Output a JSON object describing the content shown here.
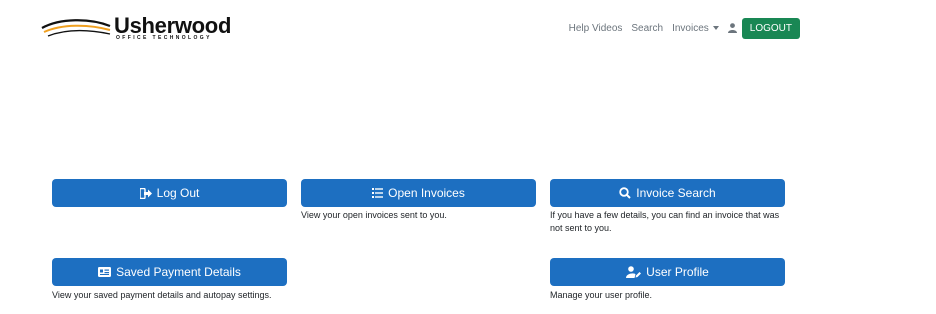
{
  "brand": {
    "name": "Usherwood",
    "tagline": "OFFICE TECHNOLOGY",
    "accent": "#f0a020"
  },
  "nav": {
    "help_videos": "Help Videos",
    "search": "Search",
    "invoices": "Invoices",
    "user_icon": "user-icon",
    "logout": "LOGOUT"
  },
  "colors": {
    "primary": "#1d6fc1",
    "success": "#198754",
    "muted": "#6c757d"
  },
  "tiles": {
    "logout": {
      "label": "Log Out",
      "icon": "sign-out-icon",
      "description": ""
    },
    "open_invoices": {
      "label": "Open Invoices",
      "icon": "list-icon",
      "description": "View your open invoices sent to you."
    },
    "invoice_search": {
      "label": "Invoice Search",
      "icon": "search-icon",
      "description": "If you have a few details, you can find an invoice that was not sent to you."
    },
    "saved_payment": {
      "label": "Saved Payment Details",
      "icon": "id-card-icon",
      "description": "View your saved payment details and autopay settings."
    },
    "user_profile": {
      "label": "User Profile",
      "icon": "user-edit-icon",
      "description": "Manage your user profile."
    }
  }
}
